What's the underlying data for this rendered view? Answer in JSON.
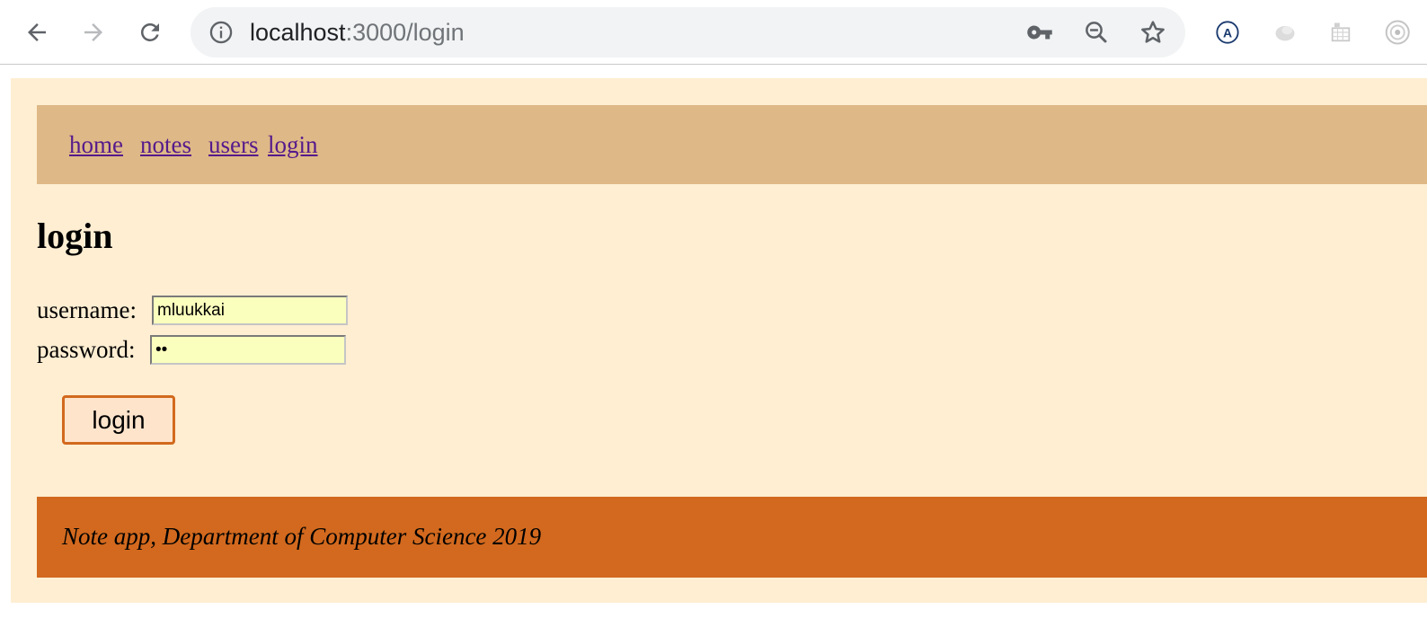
{
  "browser": {
    "url_host": "localhost",
    "url_path": ":3000/login",
    "back_icon": "back-arrow-icon",
    "forward_icon": "forward-arrow-icon",
    "reload_icon": "reload-icon",
    "info_icon": "info-icon",
    "key_icon": "key-icon",
    "zoom_icon": "zoom-out-icon",
    "star_icon": "star-icon",
    "extensions": [
      "translate-extension-icon",
      "cloud-extension-icon",
      "grid-extension-icon",
      "target-extension-icon"
    ]
  },
  "nav": {
    "home": "home",
    "notes": "notes",
    "users": "users",
    "login": "login",
    "link_color": "#551a8b",
    "background": "#deb887"
  },
  "page": {
    "title": "login",
    "background": "#ffeed2"
  },
  "form": {
    "username_label": "username:",
    "username_value": "mluukkai",
    "password_label": "password:",
    "password_value": "ab",
    "input_background": "#fbffbd",
    "submit_label": "login",
    "submit_border": "#d2691e"
  },
  "footer": {
    "text": "Note app, Department of Computer Science 2019",
    "background": "#d2691e"
  }
}
